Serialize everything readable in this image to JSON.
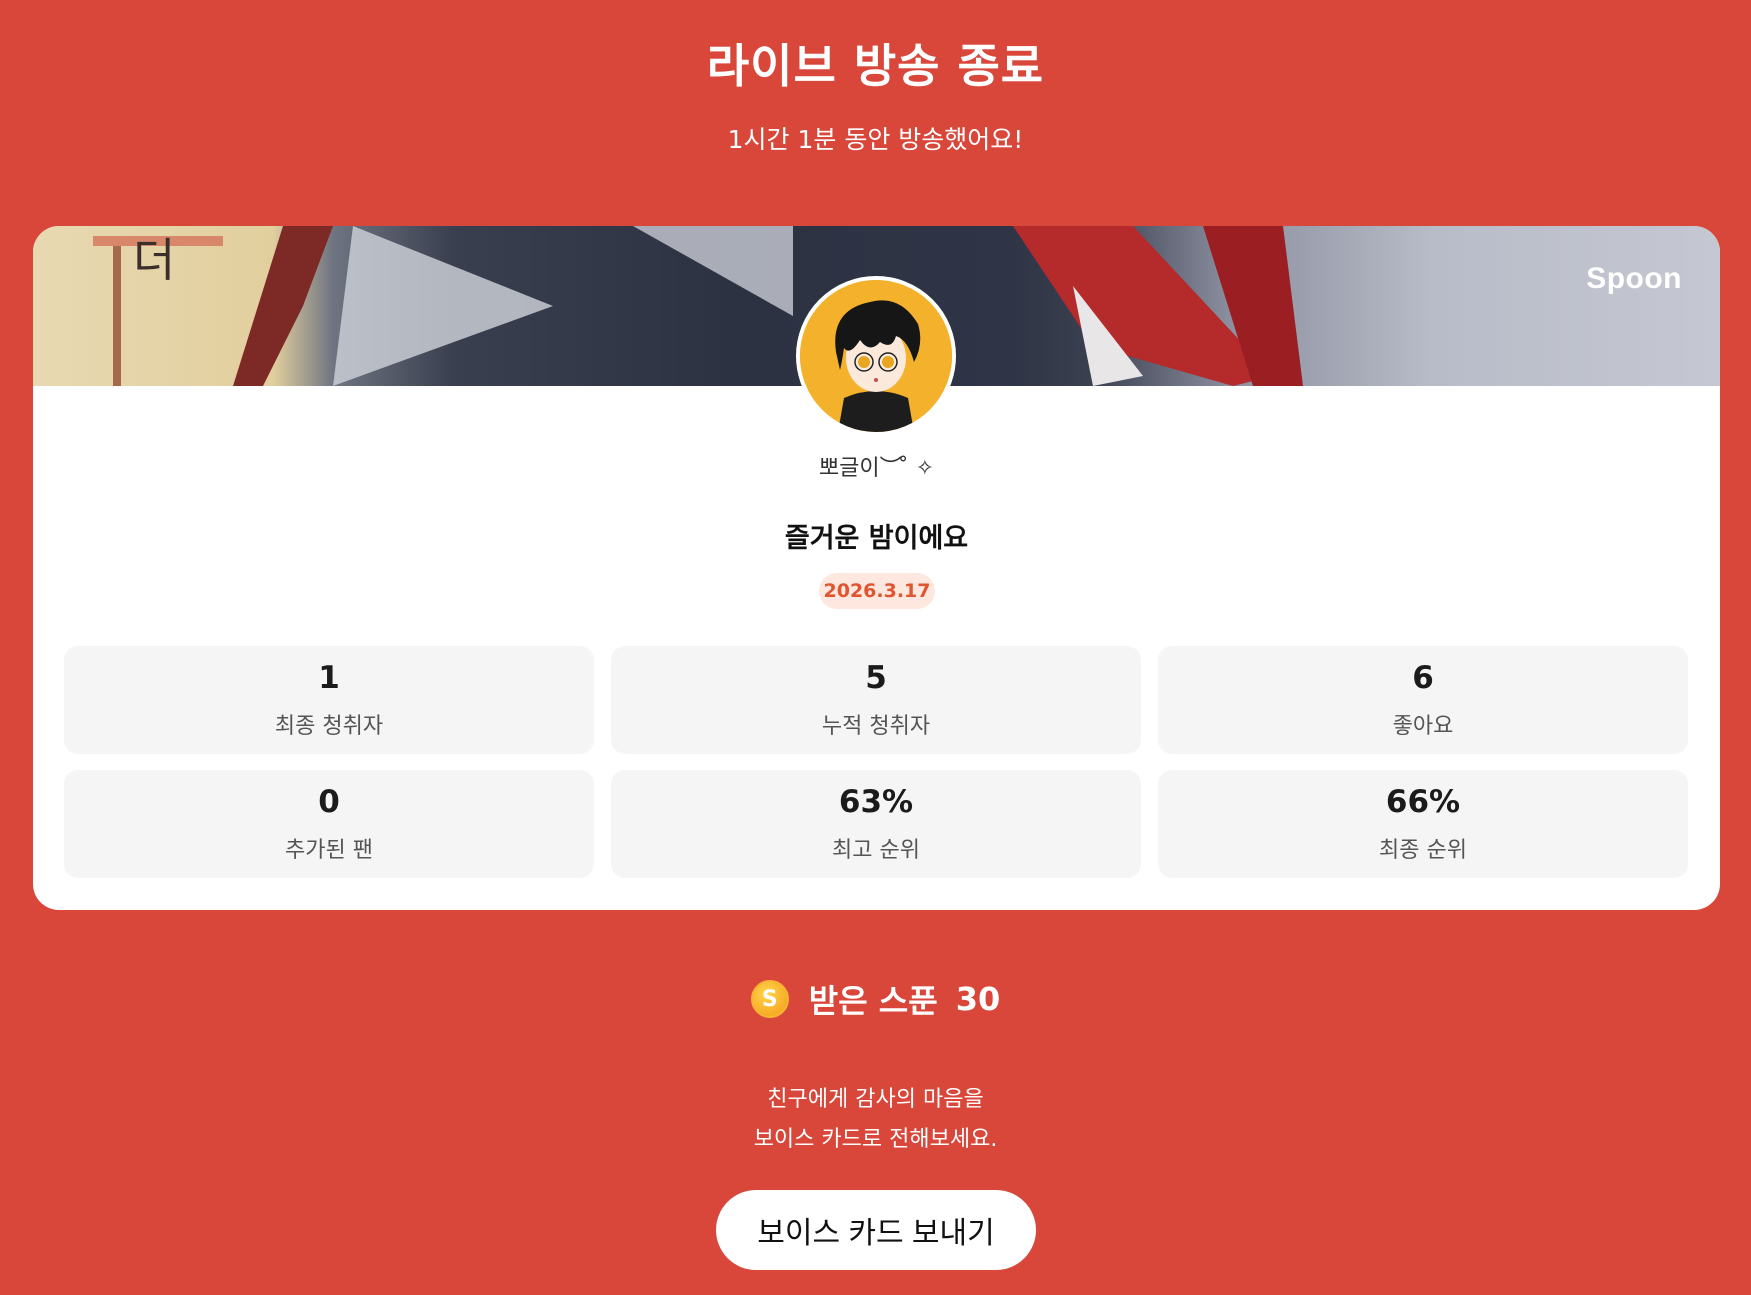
{
  "header": {
    "title": "라이브 방송 종료",
    "subtitle": "1시간 1분 동안 방송했어요!"
  },
  "card": {
    "brand": "Spoon",
    "nickname": "뽀글이︶ ̊ ✧",
    "live_title": "즐거운 밤이에요",
    "date": "2026.3.17",
    "stats": [
      {
        "value": "1",
        "label": "최종 청취자"
      },
      {
        "value": "5",
        "label": "누적 청취자"
      },
      {
        "value": "6",
        "label": "좋아요"
      },
      {
        "value": "0",
        "label": "추가된 팬"
      },
      {
        "value": "63%",
        "label": "최고 순위"
      },
      {
        "value": "66%",
        "label": "최종 순위"
      }
    ]
  },
  "spoons": {
    "coin_symbol": "S",
    "label": "받은 스푼",
    "count": "30"
  },
  "thanks": {
    "line1": "친구에게 감사의 마음을",
    "line2": "보이스 카드로 전해보세요."
  },
  "cta": {
    "label": "보이스 카드 보내기"
  },
  "colors": {
    "background": "#d8473a",
    "date_badge_bg": "#fde7de",
    "date_badge_text": "#e0552f",
    "coin": "#f5a623"
  },
  "icons": {
    "coin": "spoon-coin-icon"
  }
}
